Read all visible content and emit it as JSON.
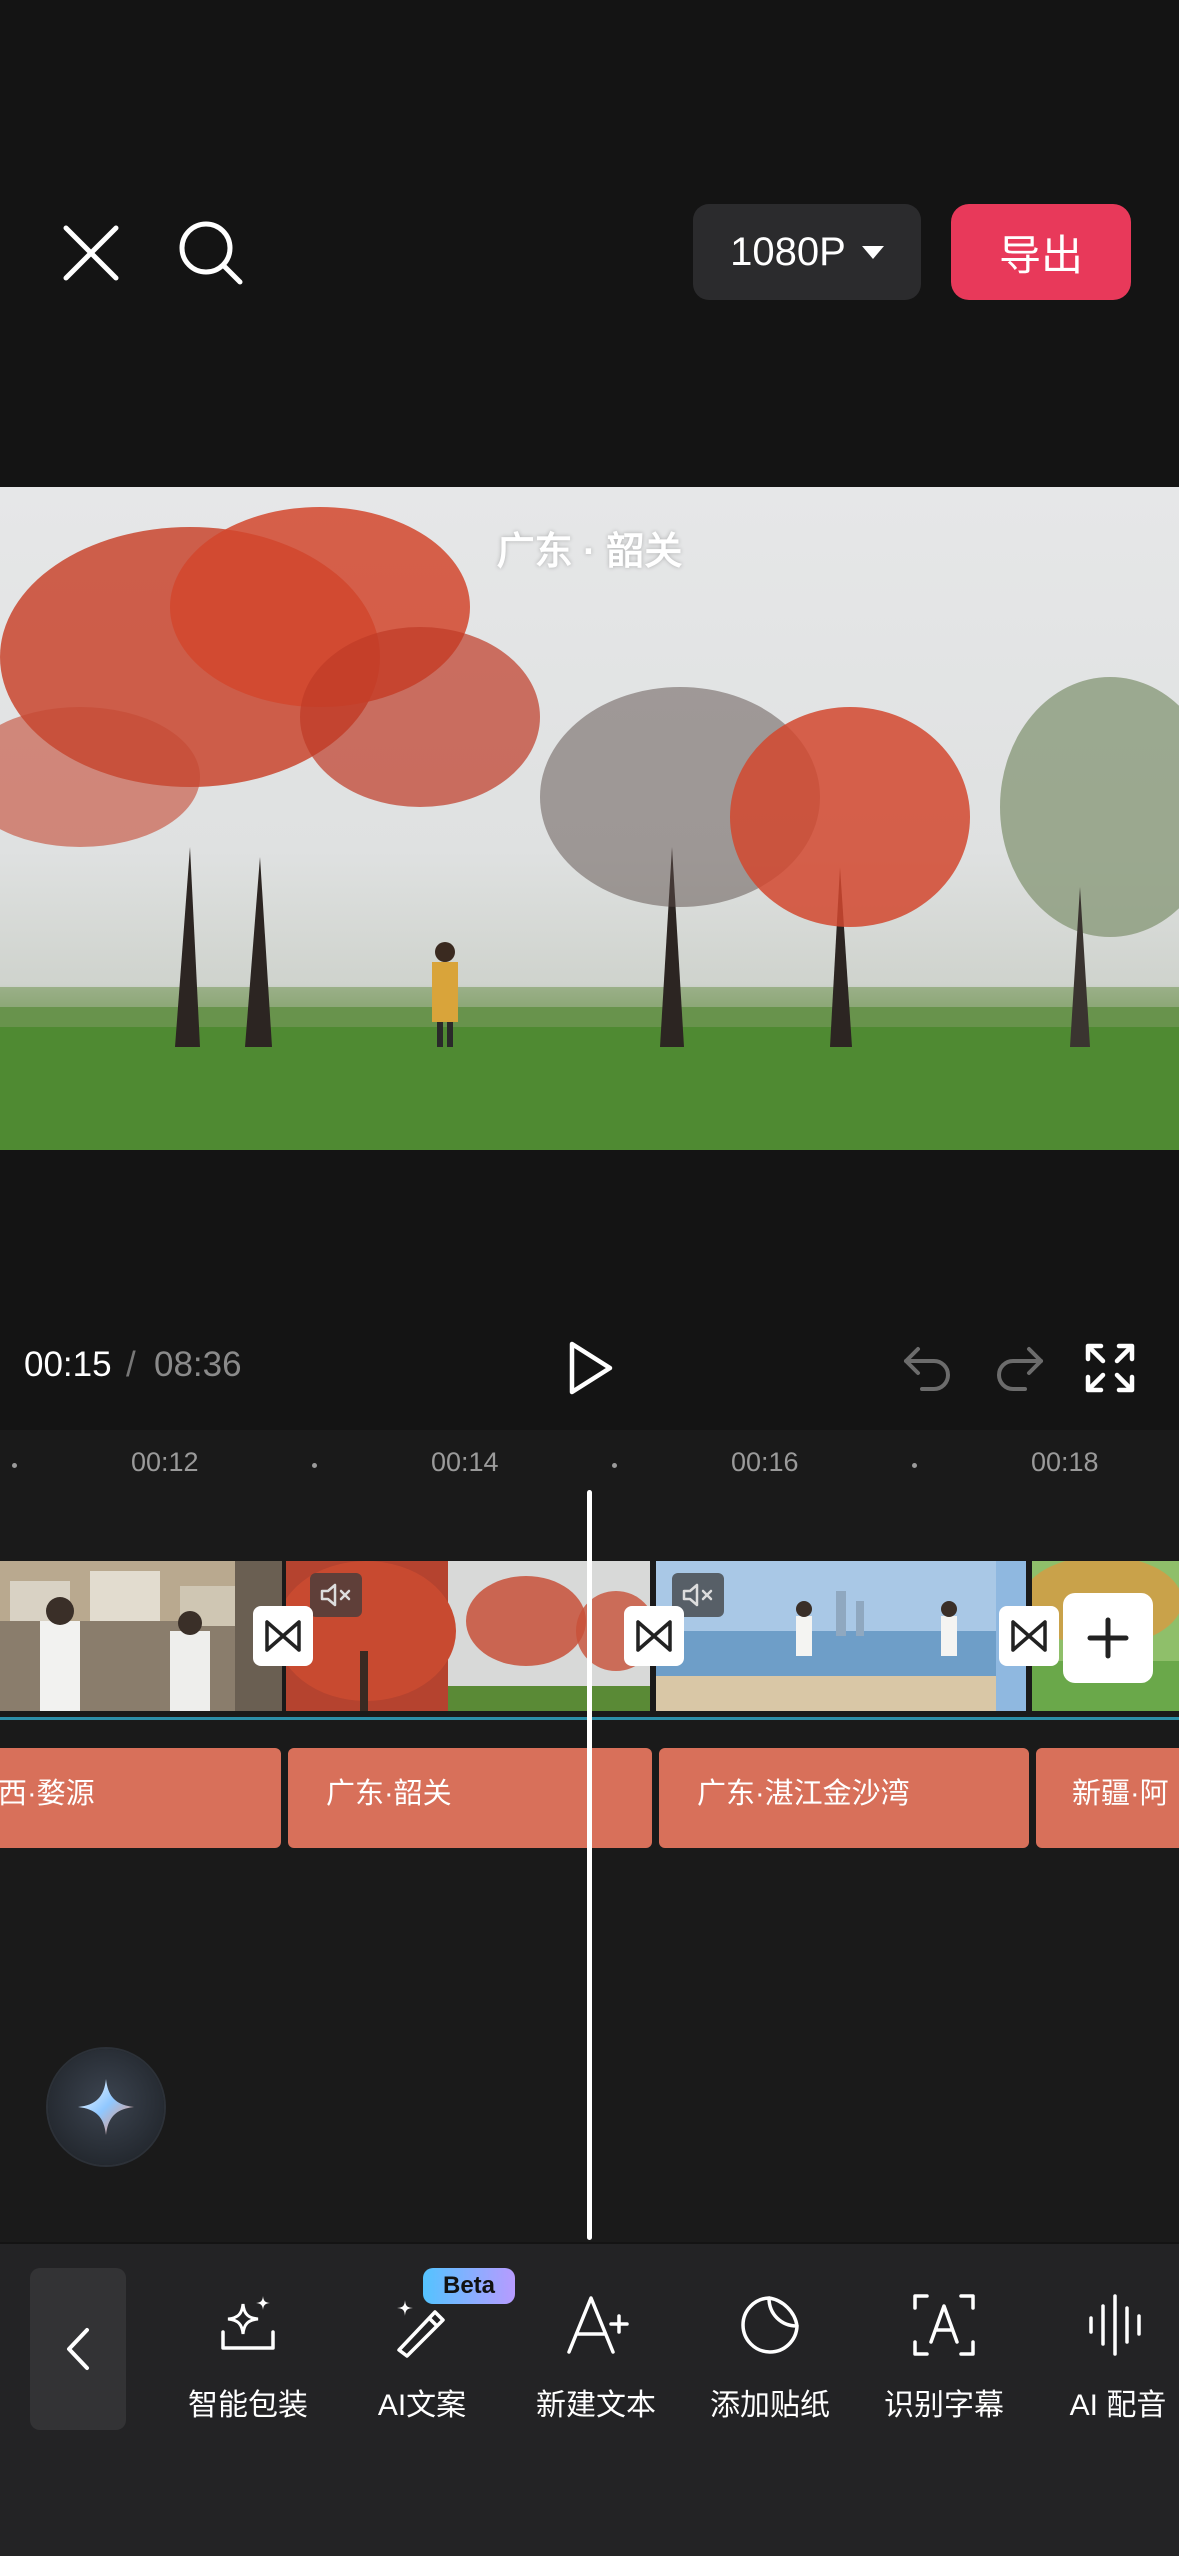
{
  "header": {
    "resolution_label": "1080P",
    "export_label": "导出"
  },
  "preview": {
    "caption": "广东 · 韶关"
  },
  "playback": {
    "current_time": "00:15",
    "separator": "/",
    "total_time": "08:36"
  },
  "timeline": {
    "ruler": [
      "00:12",
      "00:14",
      "00:16",
      "00:18"
    ],
    "text_clips": [
      "西·婺源",
      "广东·韶关",
      "广东·湛江金沙湾",
      "新疆·阿"
    ]
  },
  "toolbar": {
    "items": [
      {
        "label": "智能包装",
        "icon": "sparkle-box-icon"
      },
      {
        "label": "AI文案",
        "icon": "magic-wand-icon"
      },
      {
        "label": "新建文本",
        "icon": "text-add-icon"
      },
      {
        "label": "添加贴纸",
        "icon": "sticker-icon"
      },
      {
        "label": "识别字幕",
        "icon": "subtitle-recognize-icon"
      },
      {
        "label": "AI 配音",
        "icon": "voice-wave-icon"
      }
    ],
    "beta_label": "Beta"
  },
  "colors": {
    "background": "#141414",
    "export_button": "#e8395a",
    "text_clip": "#d8705a",
    "track_line": "#2c8ea8"
  }
}
